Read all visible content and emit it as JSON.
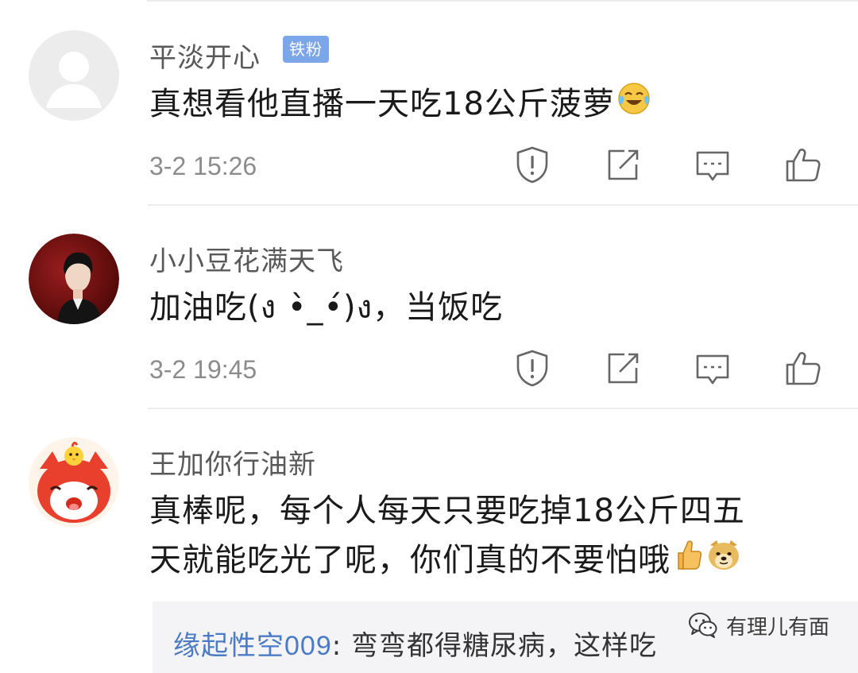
{
  "comments": [
    {
      "username": "平淡开心",
      "badge": "铁粉",
      "content": "真想看他直播一天吃18公斤菠萝",
      "content_emoji": "laughing-tears-emoji",
      "time": "3-2 15:26"
    },
    {
      "username": "小小豆花满天飞",
      "content": "加油吃(ง •̀_•́)ง，当饭吃",
      "time": "3-2 19:45"
    },
    {
      "username": "王加你行油新",
      "content_line1": "真棒呢，每个人每天只要吃掉18公斤四五",
      "content_line2": "天就能吃光了呢，你们真的不要怕哦",
      "content_emojis": [
        "thumbs-up-emoji",
        "doge-emoji"
      ]
    }
  ],
  "reply": {
    "username": "缘起性空009",
    "separator": ": ",
    "text": "弯弯都得糖尿病，这样吃"
  },
  "watermark": {
    "text": "有理儿有面",
    "icon": "wechat-icon"
  },
  "actions": [
    "report-icon",
    "share-icon",
    "comment-icon",
    "like-icon"
  ],
  "colors": {
    "username": "#595959",
    "badge_bg": "#7ba6e8",
    "reply_user": "#4a7bc4",
    "time": "#8c8c8c"
  }
}
